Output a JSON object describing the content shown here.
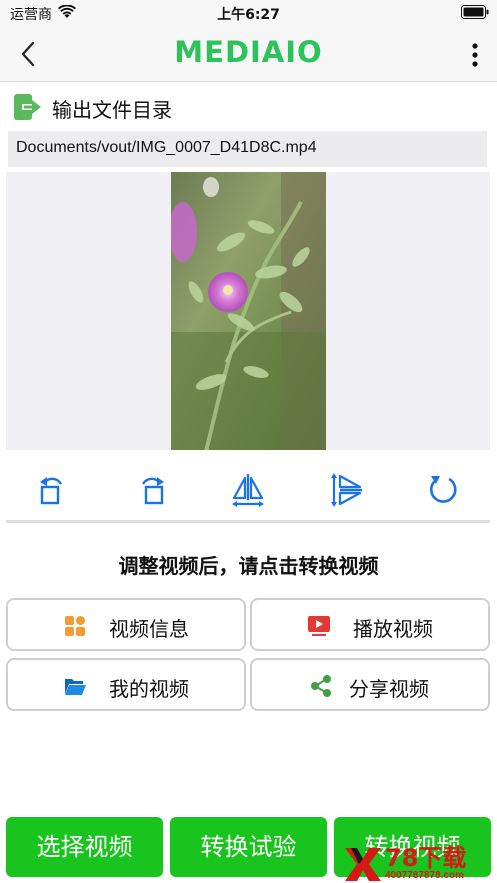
{
  "status": {
    "carrier": "运营商",
    "time": "上午6:27"
  },
  "nav": {
    "title": "MEDIAIO",
    "back_icon": "chevron-left-icon",
    "more_icon": "more-vertical-icon"
  },
  "output": {
    "label": "输出文件目录",
    "path": "Documents/vout/IMG_0007_D41D8C.mp4"
  },
  "tools": [
    {
      "icon": "rotate-left-icon"
    },
    {
      "icon": "rotate-right-icon"
    },
    {
      "icon": "flip-horizontal-icon"
    },
    {
      "icon": "flip-vertical-icon"
    },
    {
      "icon": "reset-icon"
    }
  ],
  "hint": "调整视频后，请点击转换视频",
  "actions": {
    "video_info": "视频信息",
    "play_video": "播放视频",
    "my_videos": "我的视频",
    "share_video": "分享视频"
  },
  "bottom": {
    "select_video": "选择视频",
    "convert_trial": "转换试验",
    "convert_video": "转换视频"
  },
  "watermark": {
    "text": "78下载",
    "sub": "4007787878.com"
  },
  "colors": {
    "brand": "#2ec35a",
    "accent_blue": "#1a73e8",
    "button_green": "#19c41f",
    "info_orange": "#f39c34",
    "play_red": "#e53935",
    "folder_blue": "#1e88e5",
    "share_green": "#43a047"
  }
}
